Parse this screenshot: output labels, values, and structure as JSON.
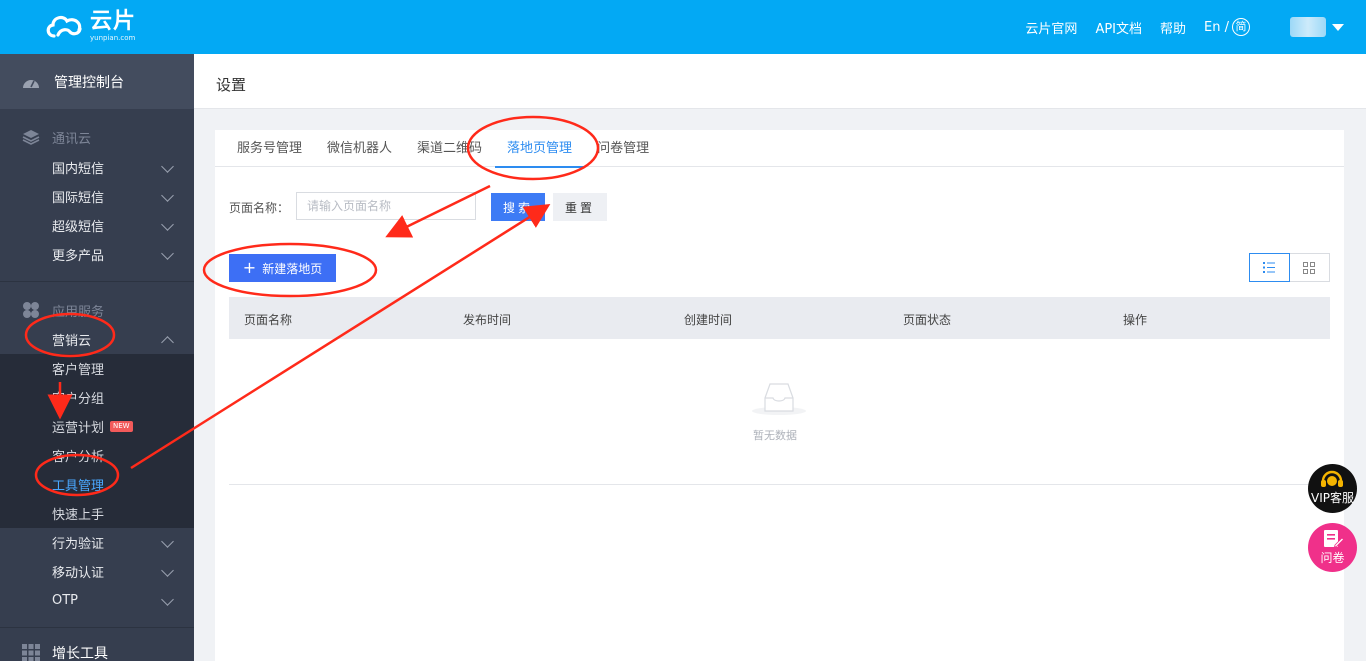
{
  "topbar": {
    "logo_cn": "云片",
    "logo_en": "yunpian.com",
    "links": [
      "云片官网",
      "API文档",
      "帮助"
    ],
    "lang_en": "En /",
    "lang_cn": "简"
  },
  "sidebar": {
    "dashboard": "管理控制台",
    "section_comm": "通讯云",
    "comm_items": [
      "国内短信",
      "国际短信",
      "超级短信",
      "更多产品"
    ],
    "section_app": "应用服务",
    "marketing": "营销云",
    "marketing_sub": [
      "客户管理",
      "客户分组",
      "运营计划",
      "客户分析",
      "工具管理",
      "快速上手"
    ],
    "new_badge": "NEW",
    "app_items": [
      "行为验证",
      "移动认证",
      "OTP"
    ],
    "growth": "增长工具"
  },
  "page": {
    "title": "设置",
    "tabs": [
      "服务号管理",
      "微信机器人",
      "渠道二维码",
      "落地页管理",
      "问卷管理"
    ],
    "active_tab": 3,
    "search_label": "页面名称：",
    "search_placeholder": "请输入页面名称",
    "search_button": "搜索",
    "reset_button": "重置",
    "new_button": "新建落地页",
    "columns": [
      "页面名称",
      "发布时间",
      "创建时间",
      "页面状态",
      "操作"
    ],
    "empty_text": "暂无数据"
  },
  "floating": {
    "vip": "VIP客服",
    "survey": "问卷"
  },
  "colors": {
    "topbar": "#03a9f4",
    "sidebar": "#363e4f",
    "primary": "#3d7bf5",
    "annotation": "#ff2a1a"
  }
}
